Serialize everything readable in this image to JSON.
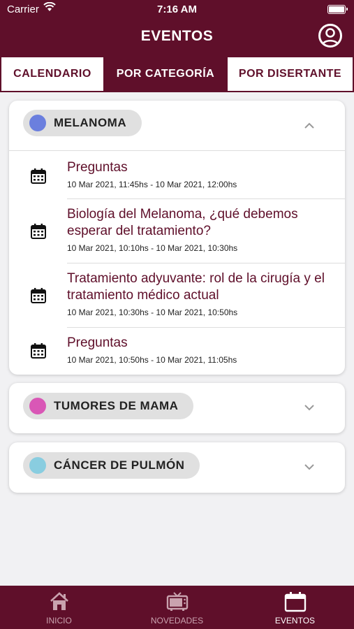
{
  "status_bar": {
    "carrier": "Carrier",
    "time": "7:16 AM"
  },
  "header": {
    "title": "EVENTOS"
  },
  "tabs": [
    {
      "label": "CALENDARIO"
    },
    {
      "label": "POR CATEGORÍA"
    },
    {
      "label": "POR DISERTANTE"
    }
  ],
  "categories": [
    {
      "name": "MELANOMA",
      "color": "#6b7fde",
      "expanded": true,
      "events": [
        {
          "title": "Preguntas",
          "time": "10 Mar 2021, 11:45hs - 10 Mar 2021, 12:00hs"
        },
        {
          "title": "Biología del Melanoma, ¿qué debemos esperar del tratamiento?",
          "time": "10 Mar 2021, 10:10hs - 10 Mar 2021, 10:30hs"
        },
        {
          "title": "Tratamiento adyuvante: rol de la cirugía y el tratamiento médico actual",
          "time": "10 Mar 2021, 10:30hs - 10 Mar 2021, 10:50hs"
        },
        {
          "title": "Preguntas",
          "time": "10 Mar 2021, 10:50hs - 10 Mar 2021, 11:05hs"
        }
      ]
    },
    {
      "name": "TUMORES DE MAMA",
      "color": "#d957b6",
      "expanded": false
    },
    {
      "name": "CÁNCER DE PULMÓN",
      "color": "#89cde0",
      "expanded": false
    }
  ],
  "bottom_nav": [
    {
      "label": "INICIO",
      "icon": "home-icon"
    },
    {
      "label": "NOVEDADES",
      "icon": "tv-icon"
    },
    {
      "label": "EVENTOS",
      "icon": "calendar-icon",
      "active": true
    }
  ],
  "colors": {
    "brand": "#5f0f2a",
    "background": "#f1f1f3"
  }
}
